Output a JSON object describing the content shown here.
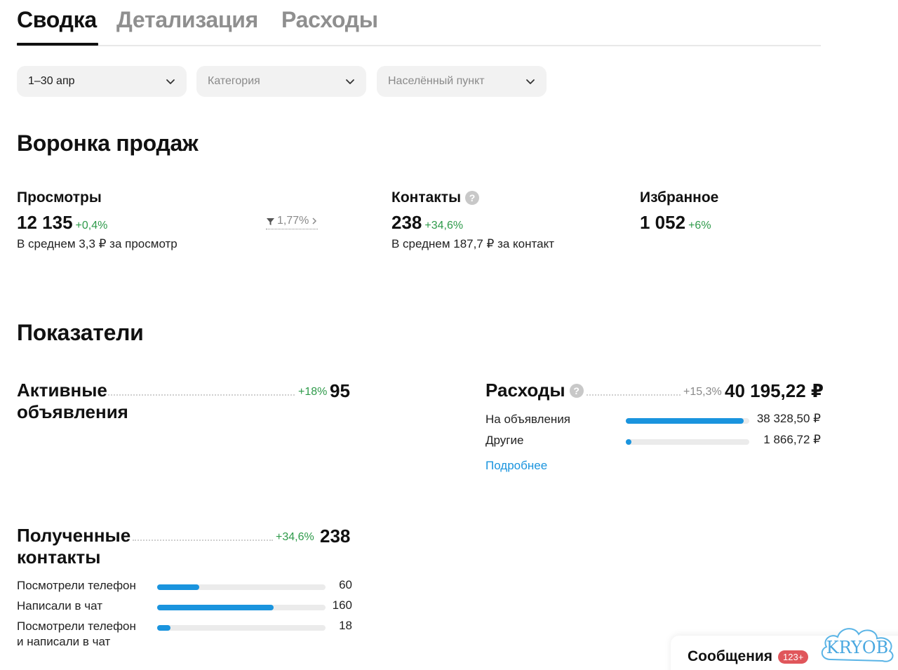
{
  "tabs": [
    {
      "label": "Сводка",
      "active": true
    },
    {
      "label": "Детализация",
      "active": false
    },
    {
      "label": "Расходы",
      "active": false
    }
  ],
  "filters": {
    "period": "1–30 апр",
    "category_placeholder": "Категория",
    "city_placeholder": "Населённый пункт"
  },
  "funnel": {
    "title": "Воронка продаж",
    "views": {
      "label": "Просмотры",
      "value": "12 135",
      "delta": "+0,4%",
      "sub": "В среднем 3,3 ₽ за просмотр"
    },
    "conversion": "1,77%",
    "contacts": {
      "label": "Контакты",
      "value": "238",
      "delta": "+34,6%",
      "sub": "В среднем 187,7 ₽ за контакт"
    },
    "favorites": {
      "label": "Избранное",
      "value": "1 052",
      "delta": "+6%"
    }
  },
  "indicators": {
    "title": "Показатели",
    "active_ads": {
      "line1": "Активные",
      "line2": "объявления",
      "delta": "+18%",
      "value": "95"
    },
    "expenses": {
      "label": "Расходы",
      "delta": "+15,3%",
      "value": "40 195,22 ₽",
      "rows": [
        {
          "label": "На объявления",
          "value": "38 328,50 ₽",
          "fraction": 0.954
        },
        {
          "label": "Другие",
          "value": "1 866,72 ₽",
          "fraction": 0.046
        }
      ],
      "more_link": "Подробнее"
    },
    "received_contacts": {
      "line1": "Полученные",
      "line2": "контакты",
      "delta": "+34,6%",
      "value": "238",
      "rows": [
        {
          "line1": "Посмотрели телефон",
          "line2": "",
          "value": "60",
          "fraction": 0.25
        },
        {
          "line1": "Написали в чат",
          "line2": "",
          "value": "160",
          "fraction": 0.69
        },
        {
          "line1": "Посмотрели телефон",
          "line2": "и написали в чат",
          "value": "18",
          "fraction": 0.08
        }
      ]
    }
  },
  "messages": {
    "label": "Сообщения",
    "badge": "123+"
  },
  "logo": {
    "text": "KRYOB"
  },
  "colors": {
    "accent": "#1a94de",
    "positive": "#2e9a4a",
    "badge": "#e0565b"
  },
  "icons": [
    "chevron-down-icon",
    "help-icon",
    "funnel-icon",
    "chevron-right-icon"
  ]
}
